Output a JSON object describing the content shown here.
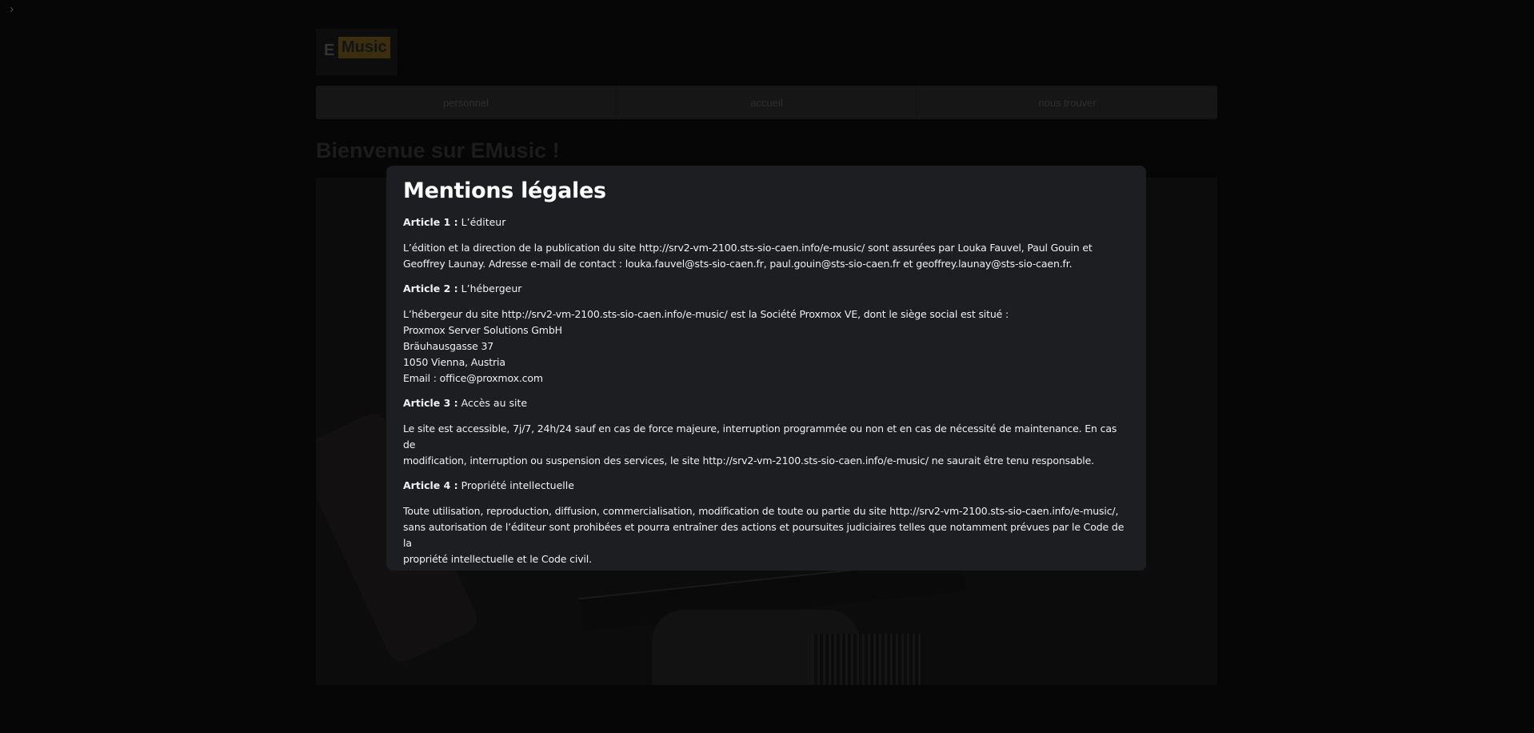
{
  "sidebar": {
    "toggle_glyph": "›"
  },
  "logo": {
    "e": "E",
    "music": "Music"
  },
  "nav": {
    "items": [
      {
        "label": "personnel"
      },
      {
        "label": "accueil"
      },
      {
        "label": "nous trouver"
      }
    ]
  },
  "welcome": {
    "title": "Bienvenue sur EMusic !"
  },
  "modal": {
    "title": "Mentions légales",
    "articles": [
      {
        "label": "Article 1 :",
        "name": "L’éditeur",
        "lines": [
          "L’édition et la direction de la publication du site http://srv2-vm-2100.sts-sio-caen.info/e-music/ sont assurées par Louka Fauvel, Paul Gouin et",
          "Geoffrey Launay. Adresse e-mail de contact : louka.fauvel@sts-sio-caen.fr, paul.gouin@sts-sio-caen.fr et geoffrey.launay@sts-sio-caen.fr."
        ]
      },
      {
        "label": "Article 2 :",
        "name": "L’hébergeur",
        "lines": [
          "L’hébergeur du site http://srv2-vm-2100.sts-sio-caen.info/e-music/ est la Société Proxmox VE, dont le siège social est situé :",
          "Proxmox Server Solutions GmbH",
          "Bräuhausgasse 37",
          "1050 Vienna, Austria",
          "Email : office@proxmox.com"
        ]
      },
      {
        "label": "Article 3 :",
        "name": "Accès au site",
        "lines": [
          "Le site est accessible, 7j/7, 24h/24 sauf en cas de force majeure, interruption programmée ou non et en cas de nécessité de maintenance. En cas de",
          "modification, interruption ou suspension des services, le site http://srv2-vm-2100.sts-sio-caen.info/e-music/ ne saurait être tenu responsable."
        ]
      },
      {
        "label": "Article 4 :",
        "name": "Propriété intellectuelle",
        "lines": [
          "Toute utilisation, reproduction, diffusion, commercialisation, modification de toute ou partie du site http://srv2-vm-2100.sts-sio-caen.info/e-music/,",
          "sans autorisation de l’éditeur sont prohibées et pourra entraîner des actions et poursuites judiciaires telles que notamment prévues par le Code de la",
          "propriété intellectuelle et le Code civil."
        ]
      }
    ]
  }
}
